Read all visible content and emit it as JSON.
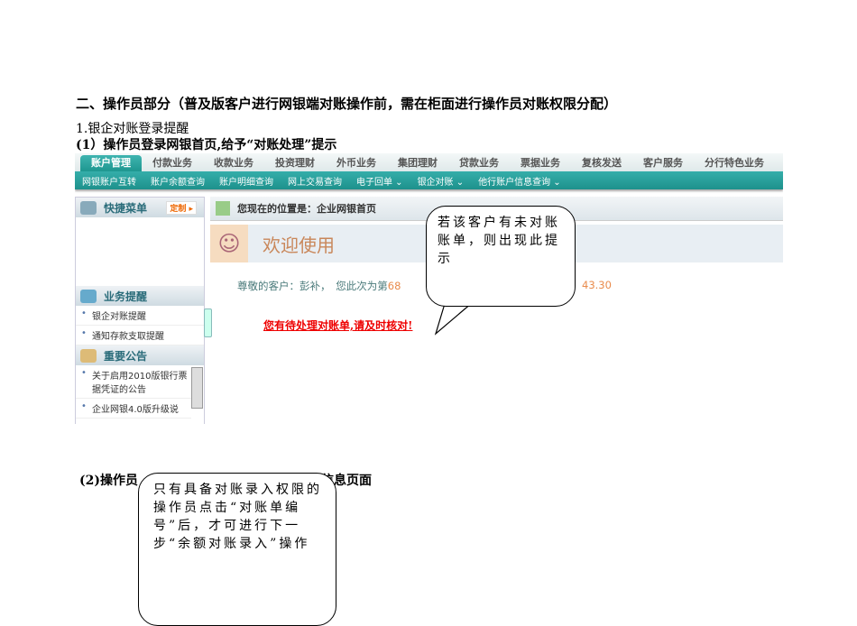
{
  "doc": {
    "heading2": "二、操作员部分（普及版客户进行网银端对账操作前，需在柜面进行操作员对账权限分配）",
    "section1": "1.银企对账登录提醒",
    "step1": "(1）操作员登录网银首页,给予“对账处理”提示",
    "step2_left": "(2)操作员",
    "step2_right": "信息页面"
  },
  "bank": {
    "tabs": [
      "账户管理",
      "付款业务",
      "收款业务",
      "投资理财",
      "外币业务",
      "集团理财",
      "贷款业务",
      "票据业务",
      "复核发送",
      "客户服务",
      "分行特色业务"
    ],
    "subnav": [
      "网银账户互转",
      "账户余额查询",
      "账户明细查询",
      "网上交易查询",
      "电子回单 ⌄",
      "银企对账 ⌄",
      "他行账户信息查询 ⌄"
    ],
    "sidebar": {
      "quick_menu": "快捷菜单",
      "customize": "定制 ▸",
      "reminders": "业务提醒",
      "reminder_items": [
        "银企对账提醒",
        "通知存款支取提醒"
      ],
      "notices": "重要公告",
      "notice_items": [
        "关于启用2010版银行票据凭证的公告",
        "企业网银4.0版升级说"
      ]
    },
    "location": "您现在的位置是：企业网银首页",
    "welcome": "欢迎使用",
    "greeting": "尊敬的客户：彭补，　您此次为第",
    "greeting_num1": "68",
    "greeting_num2": "43.30",
    "alert": "您有待处理对账单,请及时核对!"
  },
  "callouts": {
    "c1": "若该客户有未对账账单，则出现此提示",
    "c2": "只有具备对账录入权限的操作员点击“对账单编号”后，才可进行下一步“余额对账录入”操作"
  }
}
